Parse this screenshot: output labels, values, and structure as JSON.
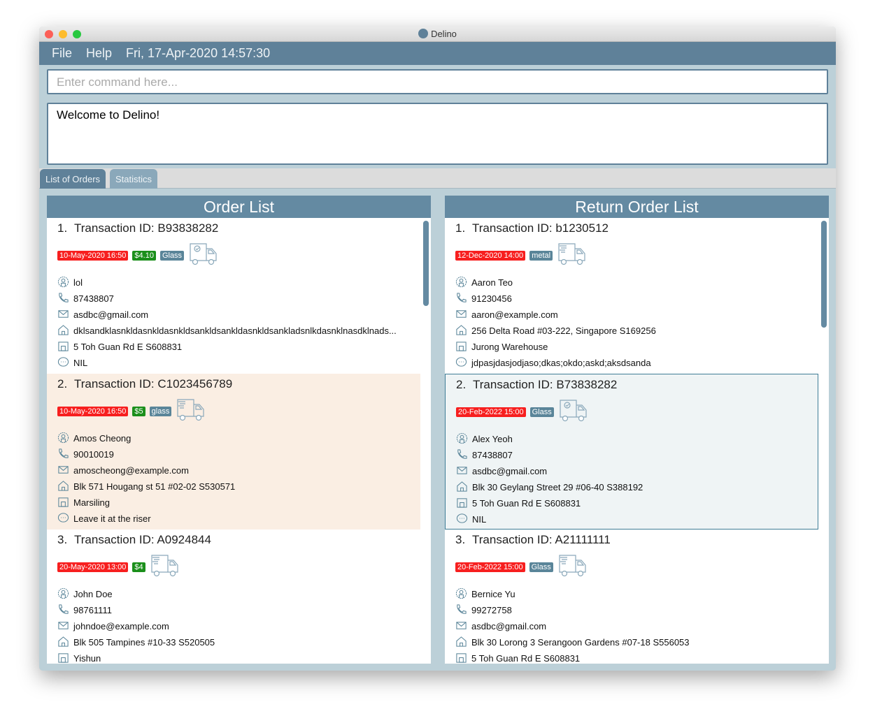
{
  "window": {
    "title": "Delino"
  },
  "menu": {
    "file": "File",
    "help": "Help",
    "datetime": "Fri, 17-Apr-2020 14:57:30"
  },
  "command": {
    "placeholder": "Enter command here..."
  },
  "result": {
    "text": "Welcome to Delino!"
  },
  "tabs": [
    {
      "label": "List of Orders",
      "active": true
    },
    {
      "label": "Statistics",
      "active": false
    }
  ],
  "colors": {
    "accent": "#5f8199",
    "date_tag": "#f71f1f",
    "cost_tag": "#1b8f1b",
    "item_tag": "#5a8599"
  },
  "order_list": {
    "title": "Order List",
    "items": [
      {
        "index": "1.",
        "tid": "Transaction ID: B93838282",
        "date": "10-May-2020 16:50",
        "cost": "$4.10",
        "item": "Glass",
        "delivered": true,
        "name": "lol",
        "phone": "87438807",
        "email": "asdbc@gmail.com",
        "address": "dklsandklasnkldasnkldasnkldsankldsankldasnkldsankladsnlkdasnklnasdklnads...",
        "warehouse": "5 Toh Guan Rd E S608831",
        "comment": "NIL",
        "state": "normal"
      },
      {
        "index": "2.",
        "tid": "Transaction ID: C1023456789",
        "date": "10-May-2020 16:50",
        "cost": "$5",
        "item": "glass",
        "delivered": false,
        "name": "Amos Cheong",
        "phone": "90010019",
        "email": "amoscheong@example.com",
        "address": "Blk 571 Hougang st 51 #02-02 S530571",
        "warehouse": "Marsiling",
        "comment": "Leave it at the riser",
        "state": "highlighted"
      },
      {
        "index": "3.",
        "tid": "Transaction ID: A0924844",
        "date": "20-May-2020 13:00",
        "cost": "$4",
        "item": "",
        "delivered": false,
        "name": "John Doe",
        "phone": "98761111",
        "email": "johndoe@example.com",
        "address": "Blk 505 Tampines #10-33 S520505",
        "warehouse": "Yishun",
        "comment": "",
        "state": "normal"
      }
    ]
  },
  "return_list": {
    "title": "Return Order List",
    "items": [
      {
        "index": "1.",
        "tid": "Transaction ID: b1230512",
        "date": "12-Dec-2020 14:00",
        "cost": "",
        "item": "metal",
        "delivered": false,
        "name": "Aaron Teo",
        "phone": "91230456",
        "email": "aaron@example.com",
        "address": "256 Delta Road #03-222, Singapore S169256",
        "warehouse": "Jurong Warehouse",
        "comment": "jdpasjdasjodjaso;dkas;okdo;askd;aksdsanda",
        "state": "normal"
      },
      {
        "index": "2.",
        "tid": "Transaction ID: B73838282",
        "date": "20-Feb-2022 15:00",
        "cost": "",
        "item": "Glass",
        "delivered": true,
        "name": "Alex Yeoh",
        "phone": "87438807",
        "email": "asdbc@gmail.com",
        "address": "Blk 30 Geylang Street 29 #06-40 S388192",
        "warehouse": "5 Toh Guan Rd E S608831",
        "comment": "NIL",
        "state": "selected"
      },
      {
        "index": "3.",
        "tid": "Transaction ID: A21111111",
        "date": "20-Feb-2022 15:00",
        "cost": "",
        "item": "Glass",
        "delivered": false,
        "name": "Bernice Yu",
        "phone": "99272758",
        "email": "asdbc@gmail.com",
        "address": "Blk 30 Lorong 3 Serangoon Gardens #07-18 S556053",
        "warehouse": "5 Toh Guan Rd E S608831",
        "comment": "",
        "state": "normal"
      }
    ]
  }
}
